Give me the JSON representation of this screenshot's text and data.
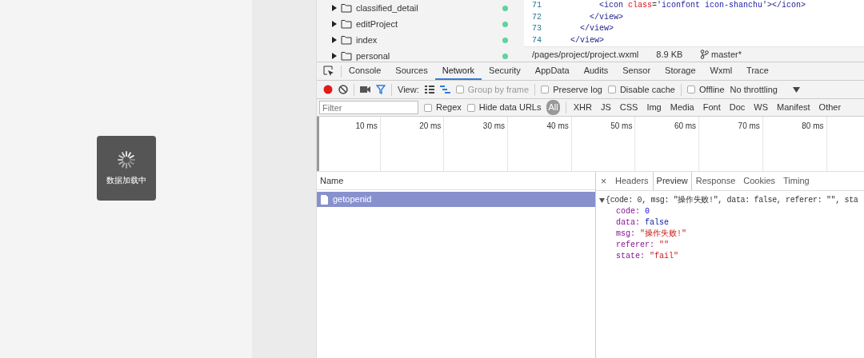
{
  "simulator": {
    "loading_toast": {
      "text": "数据加载中"
    }
  },
  "file_tree": {
    "items": [
      {
        "name": "classified_detail",
        "expanded": false
      },
      {
        "name": "editProject",
        "expanded": false
      },
      {
        "name": "index",
        "expanded": false
      },
      {
        "name": "personal",
        "expanded": false
      }
    ]
  },
  "editor": {
    "lines": [
      {
        "number": "71",
        "tokens": [
          {
            "kind": "tag",
            "text": "          <icon"
          },
          {
            "kind": "attr",
            "text": " class"
          },
          {
            "kind": "plain",
            "text": "="
          },
          {
            "kind": "string",
            "text": "'iconfont icon-shanchu'"
          },
          {
            "kind": "tag",
            "text": "></icon>"
          }
        ]
      },
      {
        "number": "72",
        "tokens": [
          {
            "kind": "tag",
            "text": "        </view>"
          }
        ]
      },
      {
        "number": "73",
        "tokens": [
          {
            "kind": "tag",
            "text": "      </view>"
          }
        ]
      },
      {
        "number": "74",
        "tokens": [
          {
            "kind": "tag",
            "text": "    </view>"
          }
        ]
      }
    ],
    "status_bar": {
      "path": "/pages/project/project.wxml",
      "size": "8.9 KB",
      "branch": "master*"
    }
  },
  "devtools": {
    "tabs": [
      {
        "label": "Console",
        "selected": false
      },
      {
        "label": "Sources",
        "selected": false
      },
      {
        "label": "Network",
        "selected": true
      },
      {
        "label": "Security",
        "selected": false
      },
      {
        "label": "AppData",
        "selected": false
      },
      {
        "label": "Audits",
        "selected": false
      },
      {
        "label": "Sensor",
        "selected": false
      },
      {
        "label": "Storage",
        "selected": false
      },
      {
        "label": "Wxml",
        "selected": false
      },
      {
        "label": "Trace",
        "selected": false
      }
    ],
    "toolbar": {
      "recording": true,
      "filter_on": true,
      "view_label": "View:",
      "large_rows": false,
      "overview": true,
      "options": [
        {
          "label": "Group by frame",
          "checked": false,
          "disabled": true
        },
        {
          "label": "Preserve log",
          "checked": false,
          "disabled": false
        },
        {
          "label": "Disable cache",
          "checked": false,
          "disabled": false
        },
        {
          "label": "Offline",
          "checked": false,
          "disabled": false
        }
      ],
      "throttling": "No throttling"
    },
    "filter_bar": {
      "placeholder": "Filter",
      "options": [
        {
          "label": "Regex",
          "checked": false
        },
        {
          "label": "Hide data URLs",
          "checked": false
        }
      ],
      "types": [
        {
          "label": "All",
          "selected": true
        },
        {
          "label": "XHR",
          "selected": false
        },
        {
          "label": "JS",
          "selected": false
        },
        {
          "label": "CSS",
          "selected": false
        },
        {
          "label": "Img",
          "selected": false
        },
        {
          "label": "Media",
          "selected": false
        },
        {
          "label": "Font",
          "selected": false
        },
        {
          "label": "Doc",
          "selected": false
        },
        {
          "label": "WS",
          "selected": false
        },
        {
          "label": "Manifest",
          "selected": false
        },
        {
          "label": "Other",
          "selected": false
        }
      ]
    },
    "timeline": {
      "ticks": [
        "10 ms",
        "20 ms",
        "30 ms",
        "40 ms",
        "50 ms",
        "60 ms",
        "70 ms",
        "80 ms"
      ]
    },
    "requests": {
      "column": "Name",
      "rows": [
        {
          "name": "getopenid",
          "selected": true
        }
      ]
    },
    "details": {
      "close": "×",
      "tabs": [
        {
          "label": "Headers",
          "selected": false
        },
        {
          "label": "Preview",
          "selected": true
        },
        {
          "label": "Response",
          "selected": false
        },
        {
          "label": "Cookies",
          "selected": false
        },
        {
          "label": "Timing",
          "selected": false
        }
      ],
      "preview": {
        "expanded": true,
        "summary": "{code: 0, msg: \"操作失败!\", data: false, referer: \"\", sta",
        "properties": [
          {
            "key": "code:",
            "value": "0",
            "kind": "number"
          },
          {
            "key": "data:",
            "value": "false",
            "kind": "boolean"
          },
          {
            "key": "msg:",
            "value": "\"操作失败!\"",
            "kind": "string"
          },
          {
            "key": "referer:",
            "value": "\"\"",
            "kind": "string"
          },
          {
            "key": "state:",
            "value": "\"fail\"",
            "kind": "string"
          }
        ]
      }
    }
  }
}
